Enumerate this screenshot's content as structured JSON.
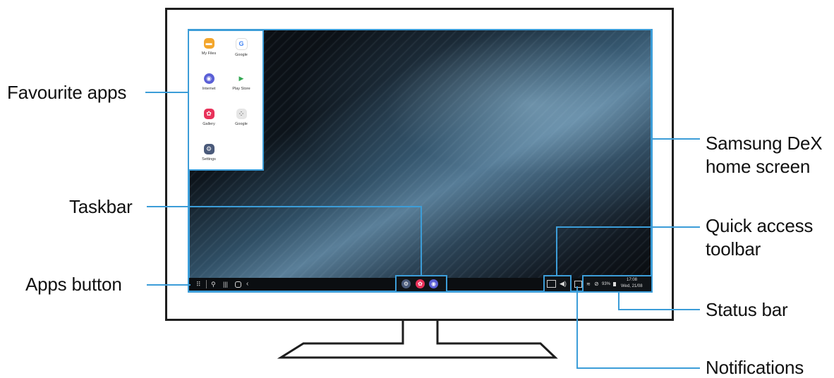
{
  "labels": {
    "favourite_apps": "Favourite apps",
    "taskbar": "Taskbar",
    "apps_button": "Apps button",
    "dex_home_line1": "Samsung DeX",
    "dex_home_line2": "home screen",
    "quick_access_line1": "Quick access",
    "quick_access_line2": "toolbar",
    "status_bar": "Status bar",
    "notifications": "Notifications"
  },
  "apps": [
    {
      "label": "My Files",
      "icon": "folder-icon",
      "color": "#f3a62c"
    },
    {
      "label": "Google",
      "icon": "google-icon",
      "color": "#ffffff"
    },
    {
      "label": "Internet",
      "icon": "internet-icon",
      "color": "#5a5fd6"
    },
    {
      "label": "Play Store",
      "icon": "play-store-icon",
      "color": "#ffffff"
    },
    {
      "label": "Gallery",
      "icon": "gallery-icon",
      "color": "#e8325a"
    },
    {
      "label": "Google",
      "icon": "google-folder-icon",
      "color": "#e6e6e6"
    },
    {
      "label": "Settings",
      "icon": "settings-icon",
      "color": "#4a5a7a"
    }
  ],
  "status": {
    "battery": "93%",
    "time": "17:08",
    "date": "Wed, 21/08"
  },
  "colors": {
    "accent": "#3c9dd8",
    "watermark": "#d9262e"
  }
}
